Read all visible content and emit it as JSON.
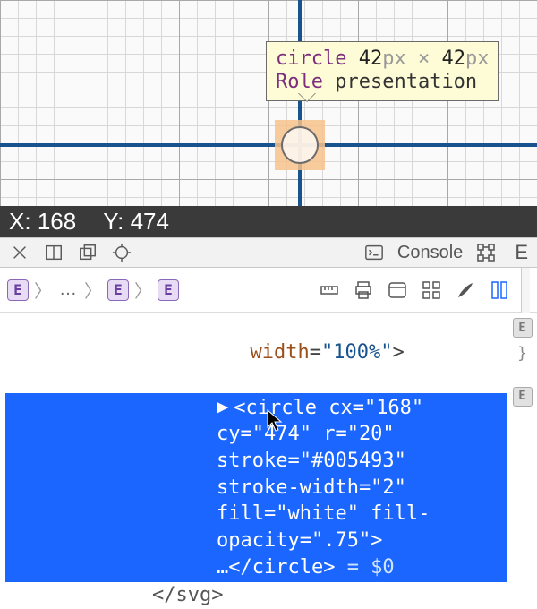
{
  "viewport": {
    "tooltip": {
      "tag": "circle",
      "width_num": "42",
      "width_unit": "px",
      "times": "×",
      "height_num": "42",
      "height_unit": "px",
      "role_label": "Role",
      "role_value": "presentation"
    }
  },
  "coord_bar": {
    "x_label": "X:",
    "x_value": "168",
    "y_label": "Y:",
    "y_value": "474"
  },
  "toolbar1": {
    "console_label": "Console",
    "trailing_letter": "E"
  },
  "breadcrumb": {
    "chip": "E",
    "sep": "〉",
    "ellipsis": "…"
  },
  "code": {
    "pre_line_attr": "width",
    "pre_line_val": "\"100%\"",
    "pre_line_close": ">",
    "selected": {
      "l1": "▶ <circle cx=\"168\"",
      "l2": "cy=\"474\"  r=\"20\"",
      "l3": "stroke=\"#005493\"",
      "l4": "stroke-width=\"2\"",
      "l5": "fill=\"white\" fill-",
      "l6": "opacity=\".75\">",
      "l7a": "…</circle>",
      "l7b": " = $0"
    },
    "tail": "</svg>"
  },
  "side": {
    "chip": "E",
    "brace": "}"
  }
}
